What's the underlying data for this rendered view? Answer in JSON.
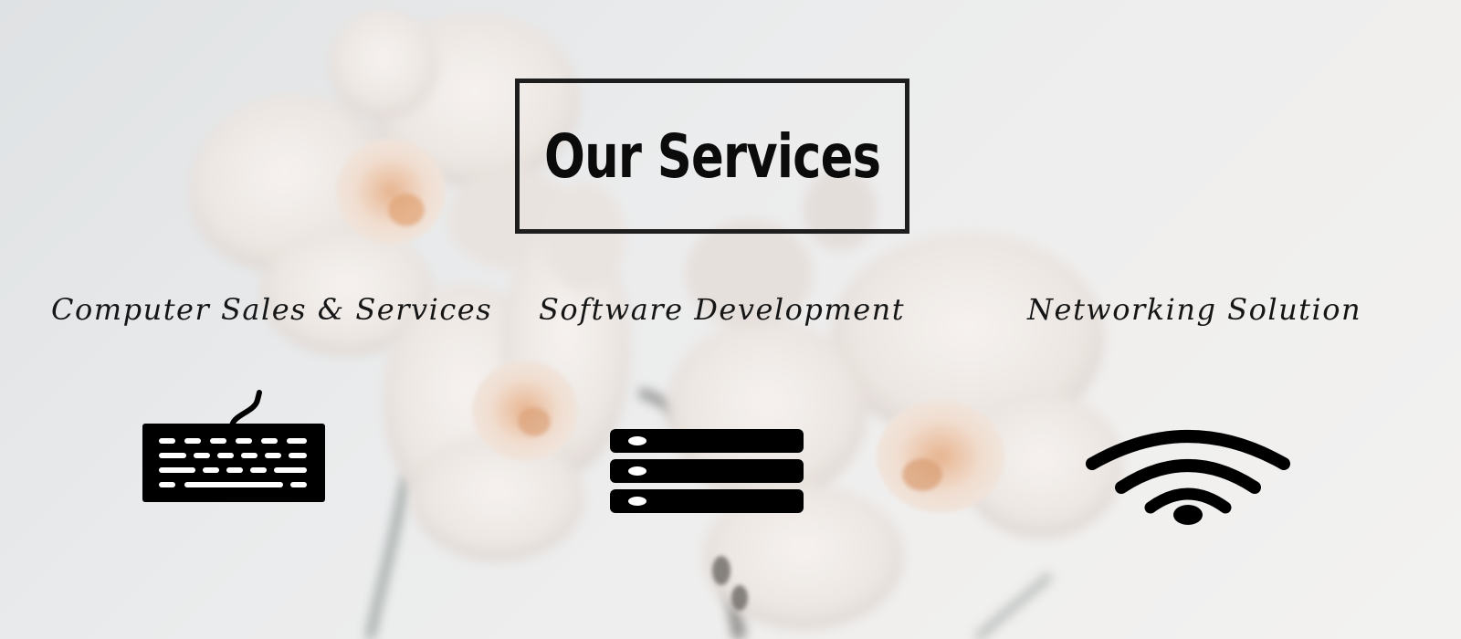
{
  "header": {
    "title": "Our Services"
  },
  "services": [
    {
      "label": "Computer Sales & Services",
      "icon": "keyboard-icon"
    },
    {
      "label": "Software Development",
      "icon": "server-icon"
    },
    {
      "label": "Networking Solution",
      "icon": "wifi-icon"
    }
  ],
  "colors": {
    "text": "#0b0b0b",
    "frame": "#1e1e1e",
    "background": "#ebeced",
    "petal": "#f3efec"
  }
}
